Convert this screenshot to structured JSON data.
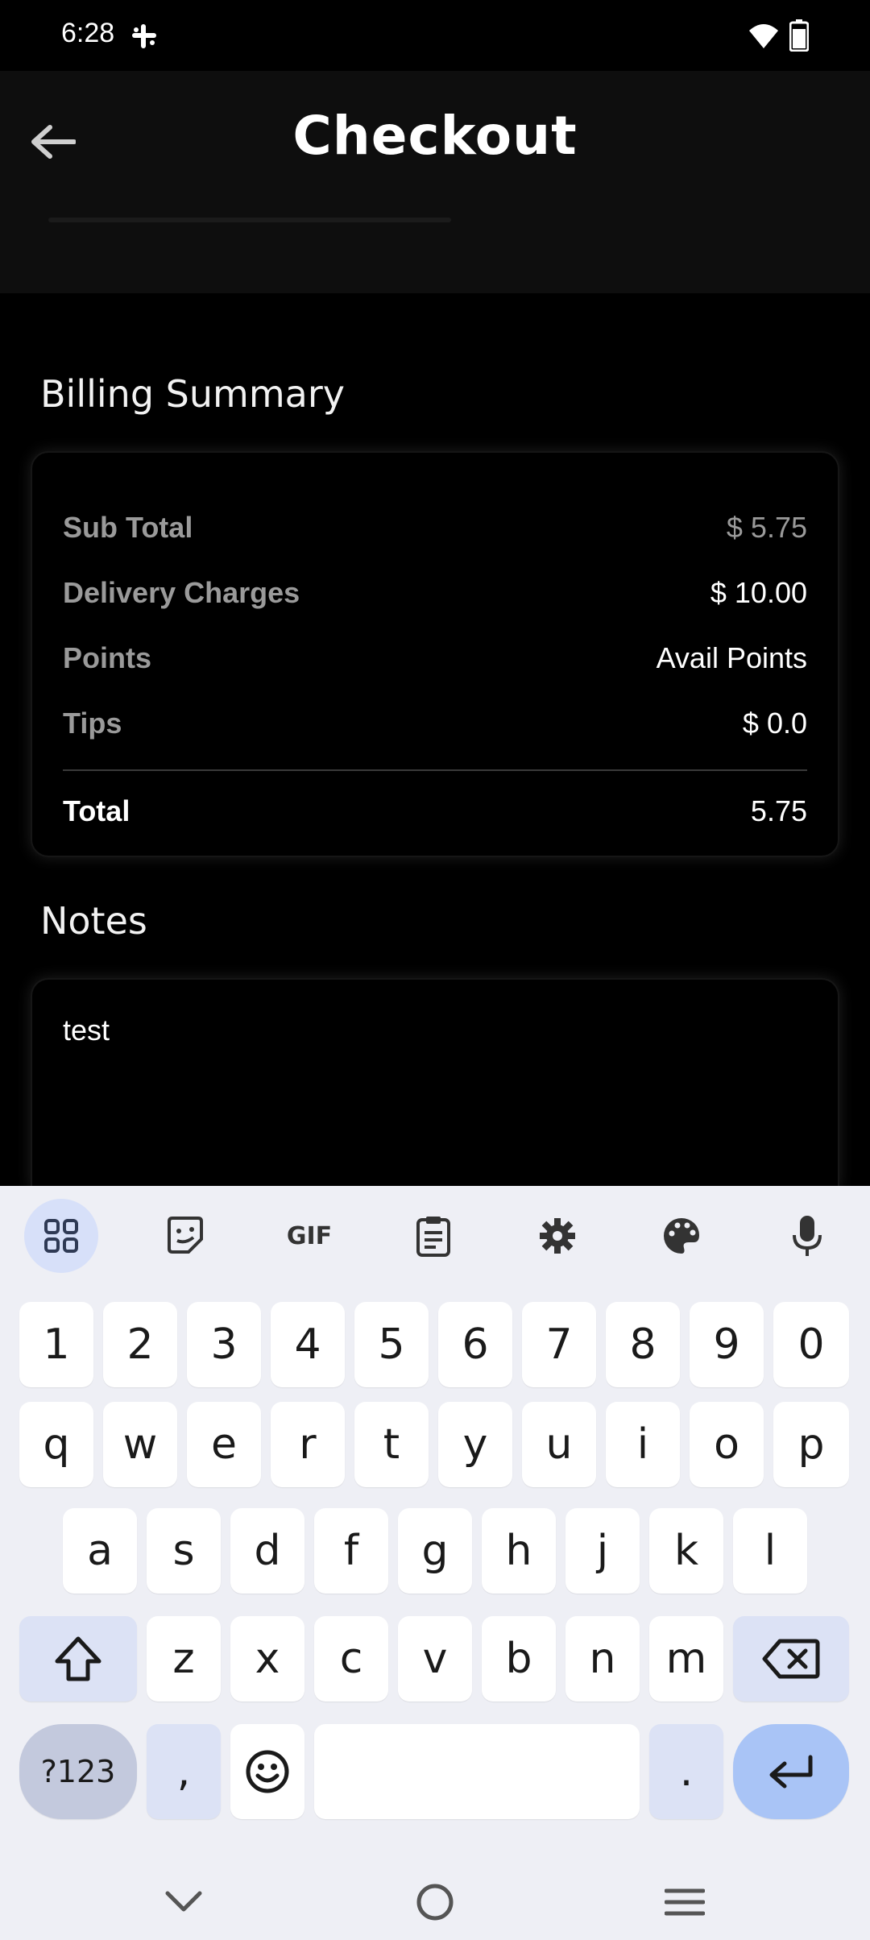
{
  "status_bar": {
    "time": "6:28"
  },
  "app_bar": {
    "title": "Checkout"
  },
  "billing": {
    "heading": "Billing Summary",
    "rows": [
      {
        "label": "Sub Total",
        "value": "$ 5.75"
      },
      {
        "label": "Delivery Charges",
        "value": "$ 10.00"
      },
      {
        "label": "Points",
        "value": "Avail Points"
      },
      {
        "label": "Tips",
        "value": "$ 0.0"
      }
    ],
    "total": {
      "label": "Total",
      "value": "5.75"
    }
  },
  "notes": {
    "heading": "Notes",
    "value": "test"
  },
  "keyboard": {
    "toolbar": [
      "apps-grid-icon",
      "sticker-icon",
      "gif-icon",
      "clipboard-icon",
      "settings-icon",
      "palette-icon",
      "microphone-icon"
    ],
    "gif_label": "GIF",
    "number_row": [
      "1",
      "2",
      "3",
      "4",
      "5",
      "6",
      "7",
      "8",
      "9",
      "0"
    ],
    "row1": [
      "q",
      "w",
      "e",
      "r",
      "t",
      "y",
      "u",
      "i",
      "o",
      "p"
    ],
    "row2": [
      "a",
      "s",
      "d",
      "f",
      "g",
      "h",
      "j",
      "k",
      "l"
    ],
    "row3": [
      "z",
      "x",
      "c",
      "v",
      "b",
      "n",
      "m"
    ],
    "symbols_label": "?123",
    "comma": ",",
    "period": "."
  },
  "colors": {
    "background": "#000000",
    "app_bar": "#0e0e0e",
    "keyboard": "#eeeff5",
    "accent_key": "#a9c4f6"
  }
}
